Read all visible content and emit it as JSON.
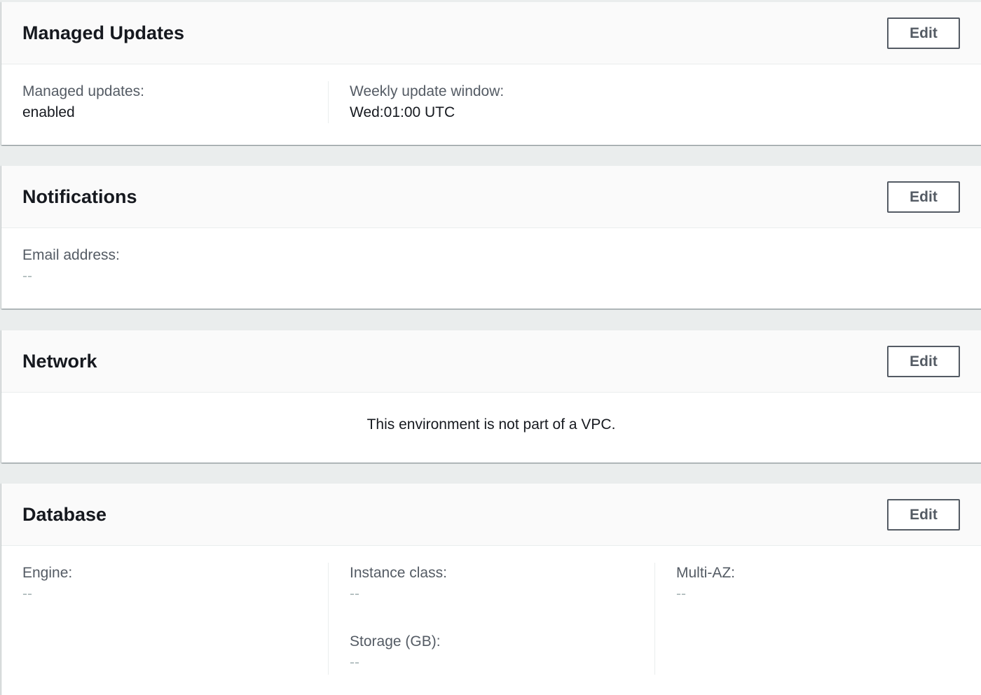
{
  "managed_updates": {
    "title": "Managed Updates",
    "edit_label": "Edit",
    "fields": [
      {
        "label": "Managed updates:",
        "value": "enabled"
      },
      {
        "label": "Weekly update window:",
        "value": "Wed:01:00 UTC"
      }
    ]
  },
  "notifications": {
    "title": "Notifications",
    "edit_label": "Edit",
    "fields": [
      {
        "label": "Email address:",
        "value": "--"
      }
    ]
  },
  "network": {
    "title": "Network",
    "edit_label": "Edit",
    "message": "This environment is not part of a VPC."
  },
  "database": {
    "title": "Database",
    "edit_label": "Edit",
    "fields": [
      {
        "label": "Engine:",
        "value": "--"
      },
      {
        "label": "Instance class:",
        "value": "--"
      },
      {
        "label": "Storage (GB):",
        "value": "--"
      },
      {
        "label": "Multi-AZ:",
        "value": "--"
      }
    ]
  },
  "colors": {
    "background": "#eaeded",
    "panel_header": "#fafafa",
    "button_border": "#545b64",
    "label_text": "#545b64",
    "empty_value": "#aab7b8"
  }
}
